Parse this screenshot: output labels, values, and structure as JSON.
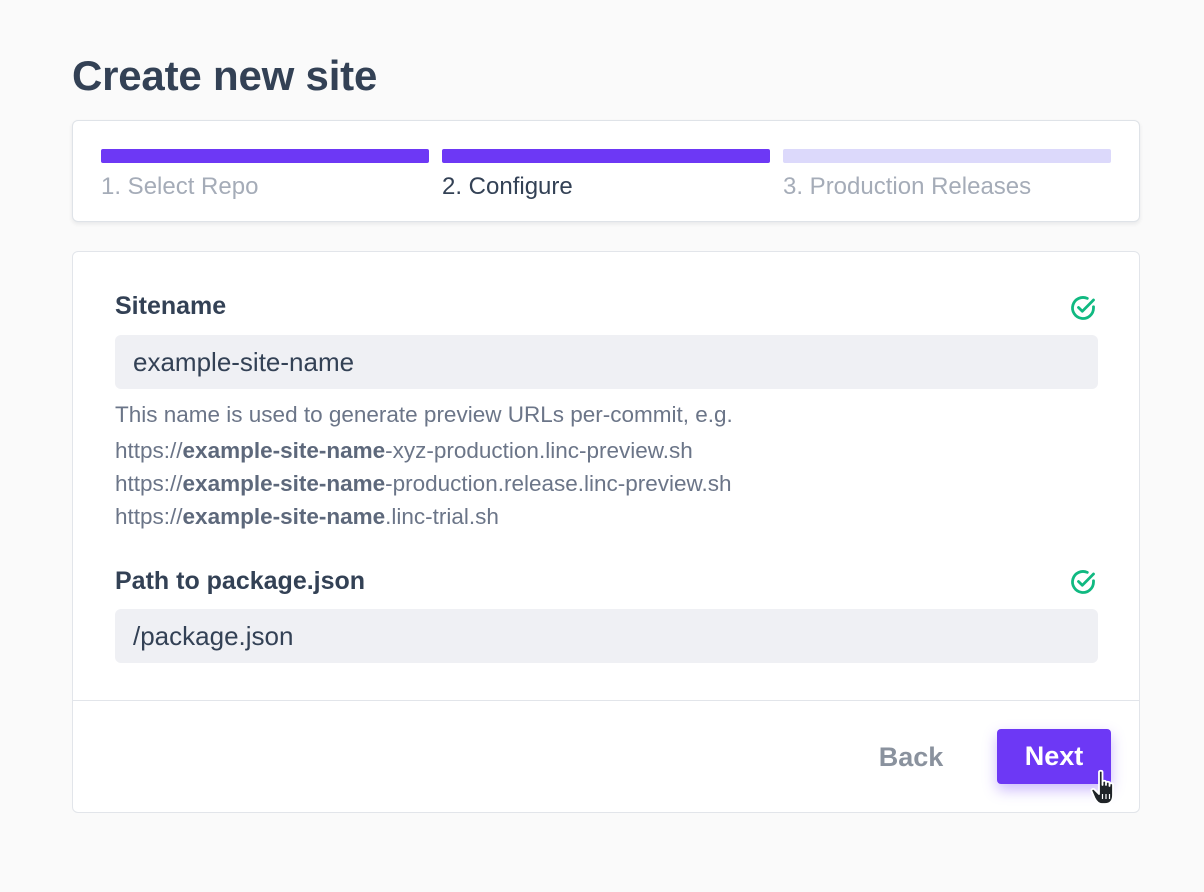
{
  "page": {
    "title": "Create new site"
  },
  "stepper": {
    "steps": [
      {
        "label": "1. Select Repo",
        "state": "done"
      },
      {
        "label": "2. Configure",
        "state": "active"
      },
      {
        "label": "3. Production Releases",
        "state": "todo"
      }
    ]
  },
  "form": {
    "sitename": {
      "label": "Sitename",
      "value": "example-site-name",
      "status_icon": "check-circle-icon",
      "help_intro": "This name is used to generate preview URLs per-commit, e.g.",
      "examples": [
        {
          "prefix": "https://",
          "name": "example-site-name",
          "suffix": "-xyz-production.linc-preview.sh"
        },
        {
          "prefix": "https://",
          "name": "example-site-name",
          "suffix": "-production.release.linc-preview.sh"
        },
        {
          "prefix": "https://",
          "name": "example-site-name",
          "suffix": ".linc-trial.sh"
        }
      ]
    },
    "package_path": {
      "label": "Path to package.json",
      "value": "/package.json",
      "status_icon": "check-circle-icon"
    }
  },
  "actions": {
    "back_label": "Back",
    "next_label": "Next"
  },
  "colors": {
    "accent": "#6d38f5",
    "accent_light": "#dcd9fb",
    "success": "#10b981",
    "text": "#334155"
  }
}
